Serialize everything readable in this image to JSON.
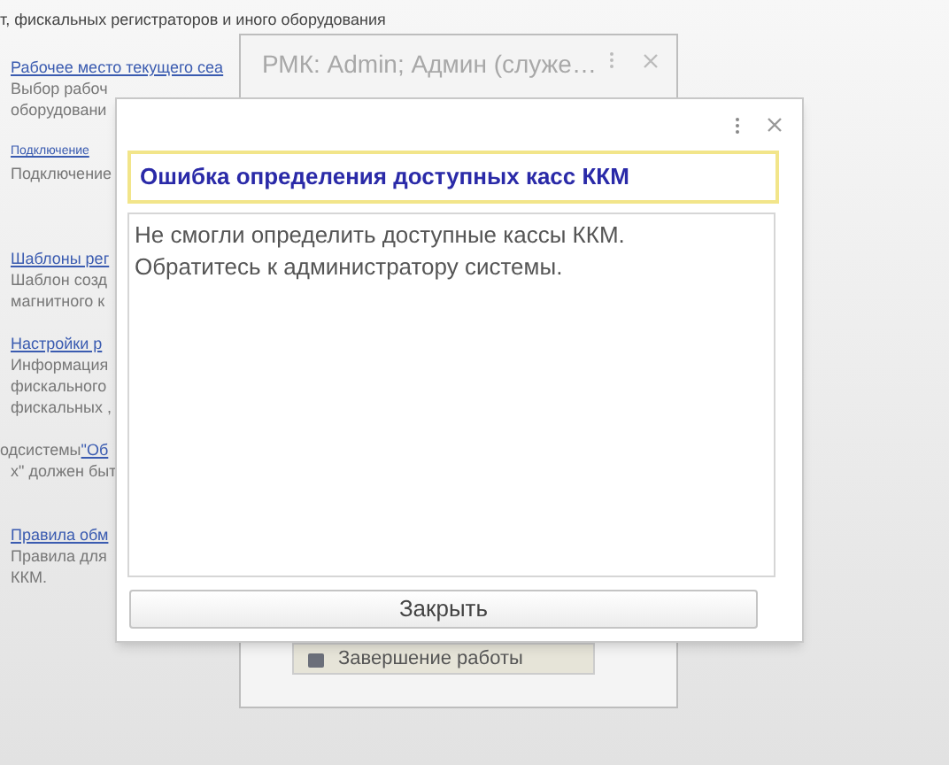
{
  "background": {
    "header": "т, фискальных регистраторов и иного оборудования",
    "lines": [
      {
        "kind": "link",
        "text": "Рабочее место текущего сеа"
      },
      {
        "kind": "text",
        "text": "Выбор рабоч"
      },
      {
        "kind": "text",
        "text": "оборудовани"
      },
      {
        "kind": "gap"
      },
      {
        "kind": "smalllink",
        "text": "Подключение"
      },
      {
        "kind": "text",
        "text": "Подключение"
      },
      {
        "kind": "gap"
      },
      {
        "kind": "gap"
      },
      {
        "kind": "gap"
      },
      {
        "kind": "link",
        "text": "Шаблоны рег"
      },
      {
        "kind": "text",
        "text": "Шаблон созд"
      },
      {
        "kind": "text",
        "text": "магнитного к"
      },
      {
        "kind": "gap"
      },
      {
        "kind": "link",
        "text": "Настройки р"
      },
      {
        "kind": "text",
        "text": "Информация"
      },
      {
        "kind": "text",
        "text": "фискального"
      },
      {
        "kind": "text",
        "text": "фискальных ,"
      },
      {
        "kind": "gap"
      },
      {
        "kind": "mixed",
        "text": "одсистемы ",
        "link": "\"Об"
      },
      {
        "kind": "text",
        "text": "х\" должен быт"
      },
      {
        "kind": "gap"
      },
      {
        "kind": "gap"
      },
      {
        "kind": "link",
        "text": "Правила обм"
      },
      {
        "kind": "text",
        "text": "Правила для"
      },
      {
        "kind": "text",
        "text": "ККМ."
      }
    ]
  },
  "back_window": {
    "title": "РМК: Admin; Админ (служе…",
    "button": "Завершение работы"
  },
  "dialog": {
    "title": "Ошибка определения доступных касс ККМ",
    "message": "Не смогли определить доступные кассы ККМ.\nОбратитесь к администратору системы.",
    "button": "Закрыть"
  }
}
